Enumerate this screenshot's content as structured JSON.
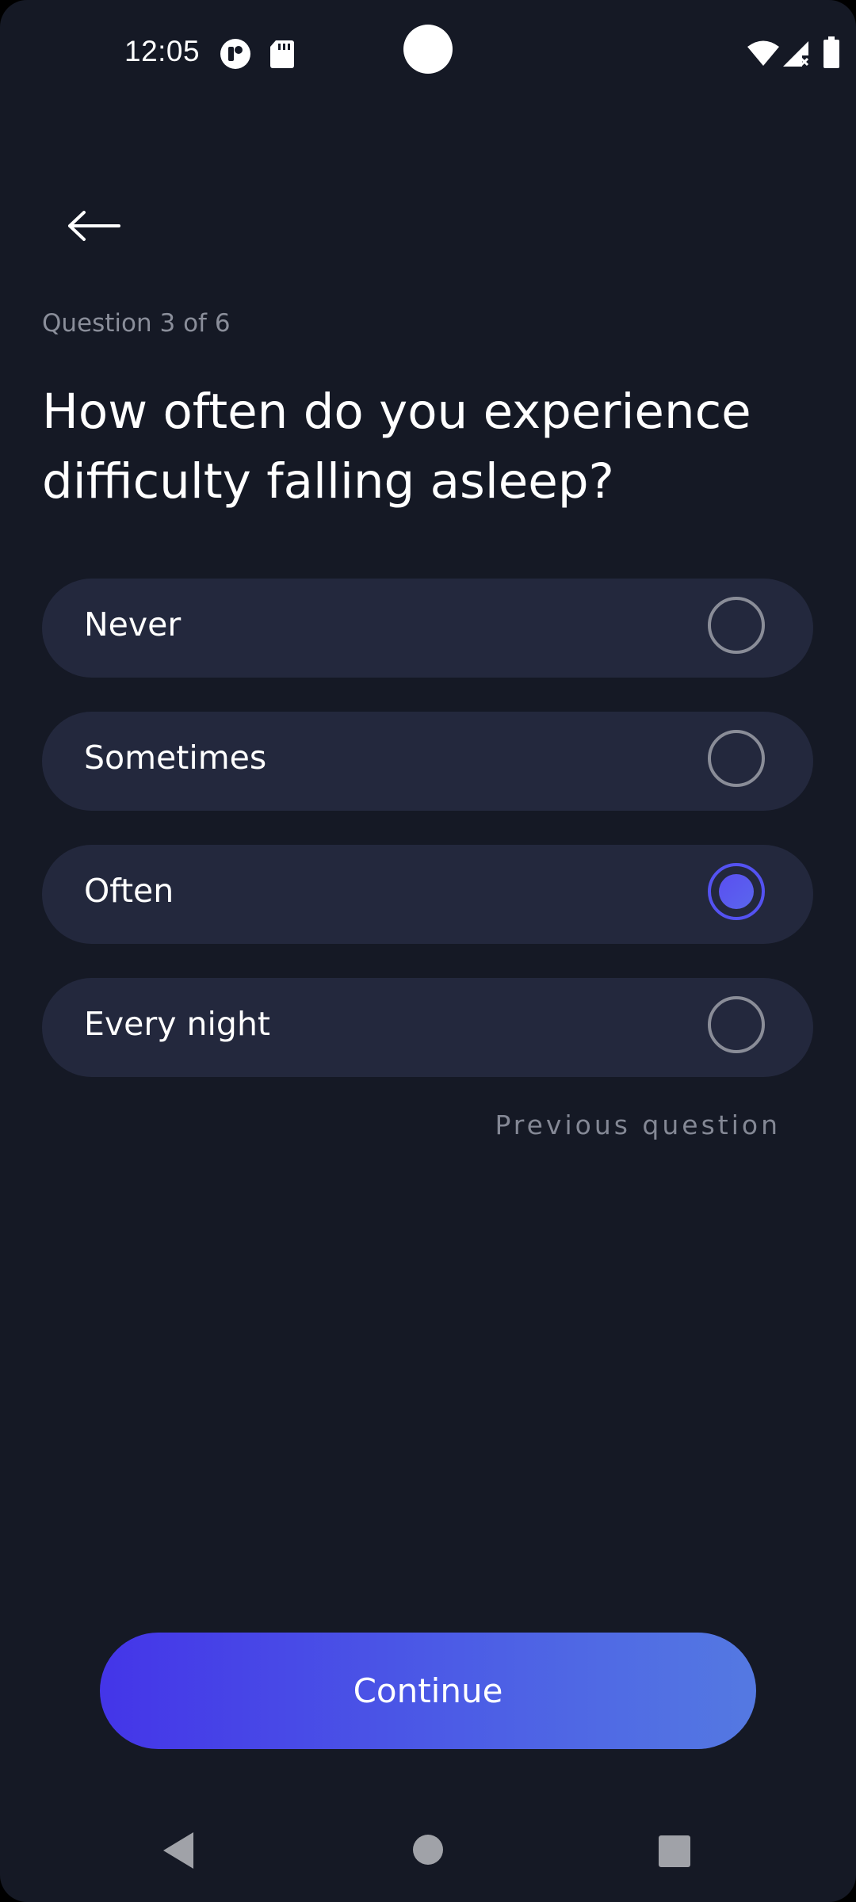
{
  "status_bar": {
    "time": "12:05",
    "icons": [
      "notification-app-icon",
      "sd-card-icon",
      "wifi-icon",
      "signal-icon",
      "battery-icon"
    ]
  },
  "header": {
    "back_icon": "arrow-left-icon"
  },
  "question": {
    "counter": "Question 3 of 6",
    "title": "How often do you experience difficulty falling asleep?"
  },
  "options": [
    {
      "label": "Never",
      "selected": false
    },
    {
      "label": "Sometimes",
      "selected": false
    },
    {
      "label": "Often",
      "selected": true
    },
    {
      "label": "Every night",
      "selected": false
    }
  ],
  "links": {
    "previous_question": "Previous question"
  },
  "footer": {
    "continue_label": "Continue"
  },
  "colors": {
    "background": "#151925",
    "option_background": "#23283d",
    "accent": "#5452f2",
    "button_gradient_start": "#4435e8",
    "button_gradient_end": "#5479e2",
    "muted_text": "#8a8e9a"
  },
  "nav_bar": {
    "icons": [
      "nav-back-icon",
      "nav-home-icon",
      "nav-recents-icon"
    ]
  }
}
